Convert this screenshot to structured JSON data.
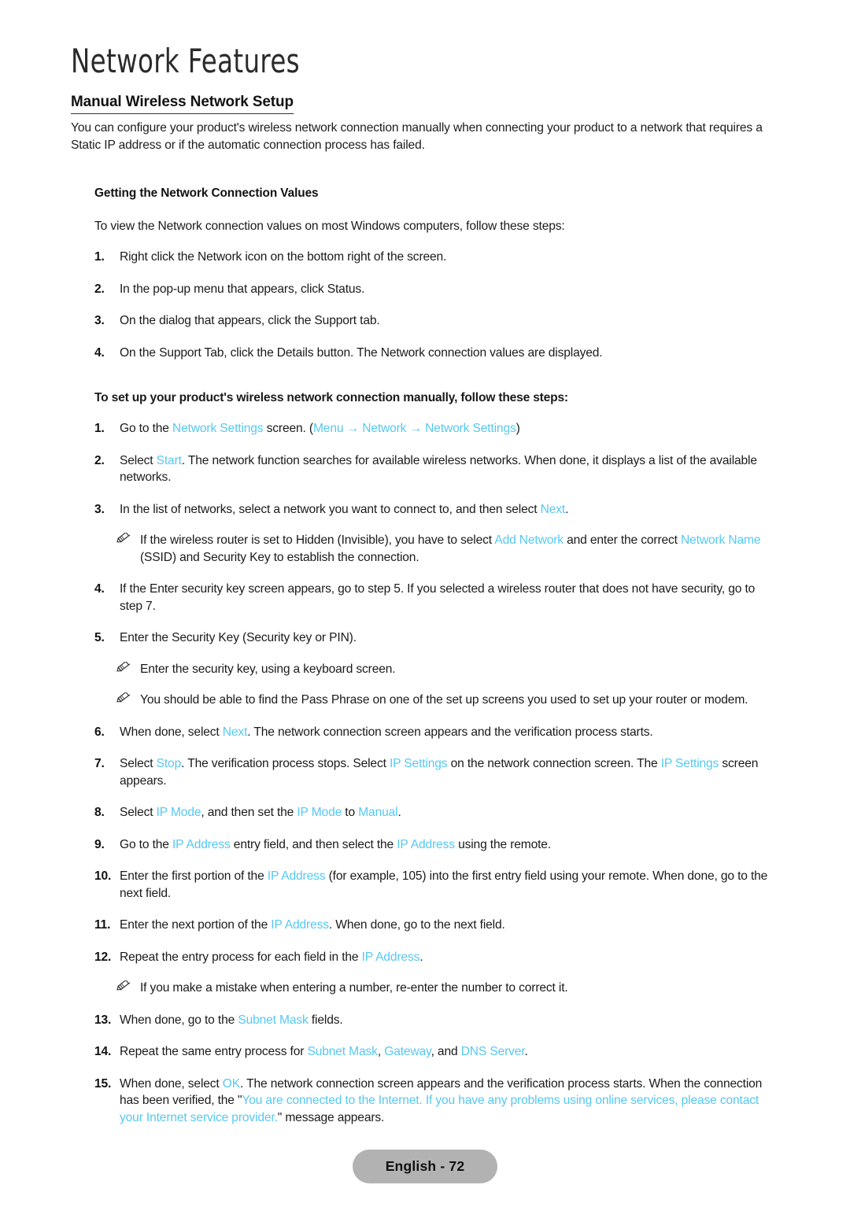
{
  "document": {
    "chapter_title": "Network Features",
    "section_heading": "Manual Wireless Network Setup",
    "intro": "You can configure your product's wireless network connection manually when connecting your product to a network that requires a Static IP address or if the automatic connection process has failed.",
    "subsection_heading": "Getting the Network Connection Values",
    "subsection_lead": "To view the Network connection values on most Windows computers, follow these steps:",
    "windows_steps": [
      {
        "num": "1.",
        "text": "Right click the Network icon on the bottom right of the screen."
      },
      {
        "num": "2.",
        "text": "In the pop-up menu that appears, click Status."
      },
      {
        "num": "3.",
        "text": "On the dialog that appears, click the Support tab."
      },
      {
        "num": "4.",
        "text": "On the Support Tab, click the Details button. The Network connection values are displayed."
      }
    ],
    "manual_setup_lead": "To set up your product's wireless network connection manually, follow these steps:",
    "step1": {
      "num": "1.",
      "a": "Go to the ",
      "menu1": "Network Settings",
      "b": " screen. (",
      "menu2": "Menu",
      "arrow1": " → ",
      "menu3": "Network",
      "arrow2": " → ",
      "menu4": "Network Settings",
      "c": ")"
    },
    "step2": {
      "num": "2.",
      "a": "Select ",
      "menu1": "Start",
      "b": ". The network function searches for available wireless networks. When done, it displays a list of the available networks."
    },
    "step3": {
      "num": "3.",
      "a": "In the list of networks, select a network you want to connect to, and then select ",
      "menu1": "Next",
      "b": "."
    },
    "note3": {
      "a": "If the wireless router is set to Hidden (Invisible), you have to select ",
      "menu1": "Add Network",
      "b": " and enter the correct ",
      "menu2": "Network Name",
      "c": " (SSID) and Security Key to establish the connection."
    },
    "step4": {
      "num": "4.",
      "text": "If the Enter security key screen appears, go to step 5. If you selected a wireless router that does not have security, go to step 7."
    },
    "step5": {
      "num": "5.",
      "text": "Enter the Security Key (Security key or PIN)."
    },
    "note5a": {
      "text": "Enter the security key, using a keyboard screen."
    },
    "note5b": {
      "text": "You should be able to find the Pass Phrase on one of the set up screens you used to set up your router or modem."
    },
    "step6": {
      "num": "6.",
      "a": "When done, select ",
      "menu1": "Next",
      "b": ". The network connection screen appears and the verification process starts."
    },
    "step7": {
      "num": "7.",
      "a": "Select ",
      "menu1": "Stop",
      "b": ". The verification process stops. Select ",
      "menu2": "IP Settings",
      "c": " on the network connection screen. The ",
      "menu3": "IP Settings",
      "d": " screen appears."
    },
    "step8": {
      "num": "8.",
      "a": "Select ",
      "menu1": "IP Mode",
      "b": ", and then set the ",
      "menu2": "IP Mode",
      "c": " to ",
      "menu3": "Manual",
      "d": "."
    },
    "step9": {
      "num": "9.",
      "a": "Go to the ",
      "menu1": "IP Address",
      "b": " entry field, and then select the ",
      "menu2": "IP Address",
      "c": " using the remote."
    },
    "step10": {
      "num": "10.",
      "a": "Enter the first portion of the ",
      "menu1": "IP Address",
      "b": " (for example, 105) into the first entry field using your remote. When done, go to the next field."
    },
    "step11": {
      "num": "11.",
      "a": "Enter the next portion of the ",
      "menu1": "IP Address",
      "b": ". When done, go to the next field."
    },
    "step12": {
      "num": "12.",
      "a": "Repeat the entry process for each field in the ",
      "menu1": "IP Address",
      "b": "."
    },
    "note12": {
      "text": "If you make a mistake when entering a number, re-enter the number to correct it."
    },
    "step13": {
      "num": "13.",
      "a": "When done, go to the ",
      "menu1": "Subnet Mask",
      "b": " fields."
    },
    "step14": {
      "num": "14.",
      "a": "Repeat the same entry process for ",
      "menu1": "Subnet Mask",
      "b": ", ",
      "menu2": "Gateway",
      "c": ", and ",
      "menu3": "DNS Server",
      "d": "."
    },
    "step15": {
      "num": "15.",
      "a": "When done, select ",
      "menu1": "OK",
      "b": ". The network connection screen appears and the verification process starts. When the connection has been verified, the \"",
      "menu2": "You are connected to the Internet. If you have any problems using online services, please contact your Internet service provider.",
      "c": "\" message appears."
    }
  },
  "footer": {
    "page_label": "English - 72"
  },
  "colors": {
    "menu_term": "#56c8f2",
    "body_text": "#1c1c1c",
    "pill_background": "#b2b2b2"
  },
  "icons": {
    "note": "pencil-icon"
  }
}
